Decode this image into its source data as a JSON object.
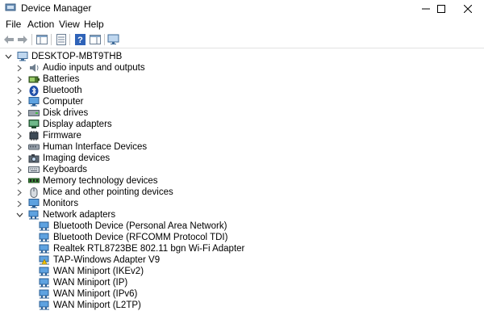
{
  "window": {
    "title": "Device Manager"
  },
  "menu": [
    "File",
    "Action",
    "View",
    "Help"
  ],
  "tree": {
    "root": "DESKTOP-MBT9THB",
    "categories": [
      {
        "label": "Audio inputs and outputs",
        "icon": "speaker-icon"
      },
      {
        "label": "Batteries",
        "icon": "battery-icon"
      },
      {
        "label": "Bluetooth",
        "icon": "bluetooth-icon"
      },
      {
        "label": "Computer",
        "icon": "computer-icon"
      },
      {
        "label": "Disk drives",
        "icon": "disk-drive-icon"
      },
      {
        "label": "Display adapters",
        "icon": "display-adapter-icon"
      },
      {
        "label": "Firmware",
        "icon": "firmware-icon"
      },
      {
        "label": "Human Interface Devices",
        "icon": "hid-icon"
      },
      {
        "label": "Imaging devices",
        "icon": "camera-icon"
      },
      {
        "label": "Keyboards",
        "icon": "keyboard-icon"
      },
      {
        "label": "Memory technology devices",
        "icon": "memory-icon"
      },
      {
        "label": "Mice and other pointing devices",
        "icon": "mouse-icon"
      },
      {
        "label": "Monitors",
        "icon": "monitor-icon"
      },
      {
        "label": "Network adapters",
        "icon": "network-adapter-icon",
        "expanded": true
      }
    ],
    "network_adapters": [
      "Bluetooth Device (Personal Area Network)",
      "Bluetooth Device (RFCOMM Protocol TDI)",
      "Realtek RTL8723BE 802.11 bgn Wi-Fi Adapter",
      "TAP-Windows Adapter V9",
      "WAN Miniport (IKEv2)",
      "WAN Miniport (IP)",
      "WAN Miniport (IPv6)",
      "WAN Miniport (L2TP)"
    ]
  }
}
